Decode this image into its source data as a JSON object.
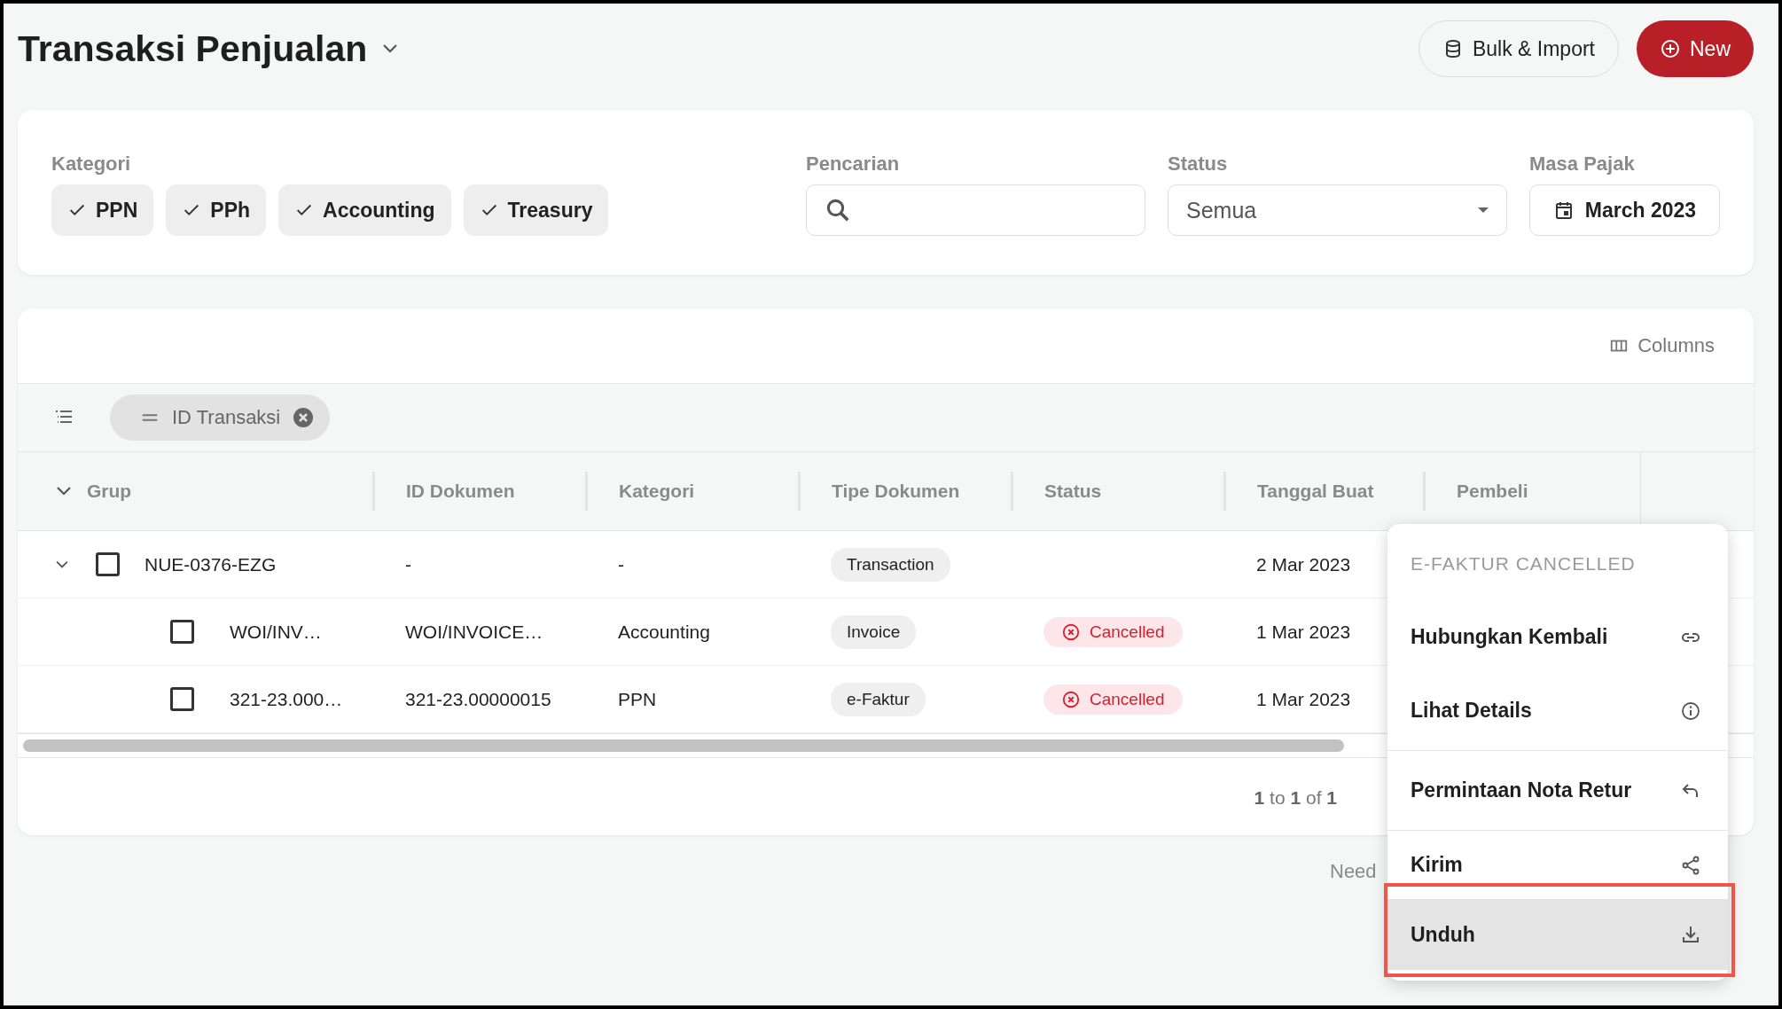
{
  "page": {
    "title": "Transaksi Penjualan",
    "actions": [
      {
        "label": "Bulk & Import",
        "kind": "secondary"
      },
      {
        "label": "New",
        "kind": "primary"
      }
    ]
  },
  "filters": {
    "kategori": {
      "label": "Kategori",
      "chips": [
        {
          "label": "PPN",
          "checked": true
        },
        {
          "label": "PPh",
          "checked": true
        },
        {
          "label": "Accounting",
          "checked": true
        },
        {
          "label": "Treasury",
          "checked": true
        }
      ]
    },
    "pencarian": {
      "label": "Pencarian"
    },
    "status": {
      "label": "Status",
      "value": "Semua"
    },
    "masa_pajak": {
      "label": "Masa Pajak",
      "value": "March 2023"
    }
  },
  "table": {
    "columns_button": "Columns",
    "group_by": {
      "label": "ID Transaksi"
    },
    "columns": [
      {
        "label": "Grup",
        "expanded": true
      },
      {
        "label": "ID Dokumen"
      },
      {
        "label": "Kategori"
      },
      {
        "label": "Tipe Dokumen"
      },
      {
        "label": "Status"
      },
      {
        "label": "Tanggal Buat"
      },
      {
        "label": "Pembeli"
      }
    ],
    "rows": [
      {
        "grup": "NUE-0376-EZG",
        "expanded": true,
        "checked": false,
        "id_dokumen": "-",
        "kategori": "-",
        "tipe_dokumen": "Transaction",
        "tanggal_buat": "2 Mar 2023",
        "children": [
          {
            "grup": "WOI/INV…",
            "checked": false,
            "id_dokumen": "WOI/INVOICE…",
            "kategori": "Accounting",
            "tipe_dokumen": "Invoice",
            "status": {
              "label": "Cancelled",
              "kind": "cancelled"
            },
            "tanggal_buat": "1 Mar 2023"
          },
          {
            "grup": "321-23.000…",
            "checked": false,
            "id_dokumen": "321-23.00000015",
            "kategori": "PPN",
            "tipe_dokumen": "e-Faktur",
            "status": {
              "label": "Cancelled",
              "kind": "cancelled"
            },
            "tanggal_buat": "1 Mar 2023"
          }
        ]
      }
    ],
    "pagination": "**1** to **1** of **1**"
  },
  "footer_text": "Need",
  "context_menu": {
    "header": "E-FAKTUR CANCELLED",
    "items": [
      {
        "label": "Hubungkan Kembali",
        "kind": "link",
        "selected": false,
        "annotated": false,
        "divider_after": false
      },
      {
        "label": "Lihat Details",
        "kind": "info",
        "selected": false,
        "annotated": false,
        "divider_after": true
      },
      {
        "label": "Permintaan Nota Retur",
        "kind": "undo",
        "selected": false,
        "annotated": false,
        "divider_after": true
      },
      {
        "label": "Kirim",
        "kind": "share",
        "selected": false,
        "annotated": false,
        "divider_after": false
      },
      {
        "label": "Unduh",
        "kind": "download",
        "selected": true,
        "annotated": true,
        "divider_after": false
      }
    ]
  }
}
